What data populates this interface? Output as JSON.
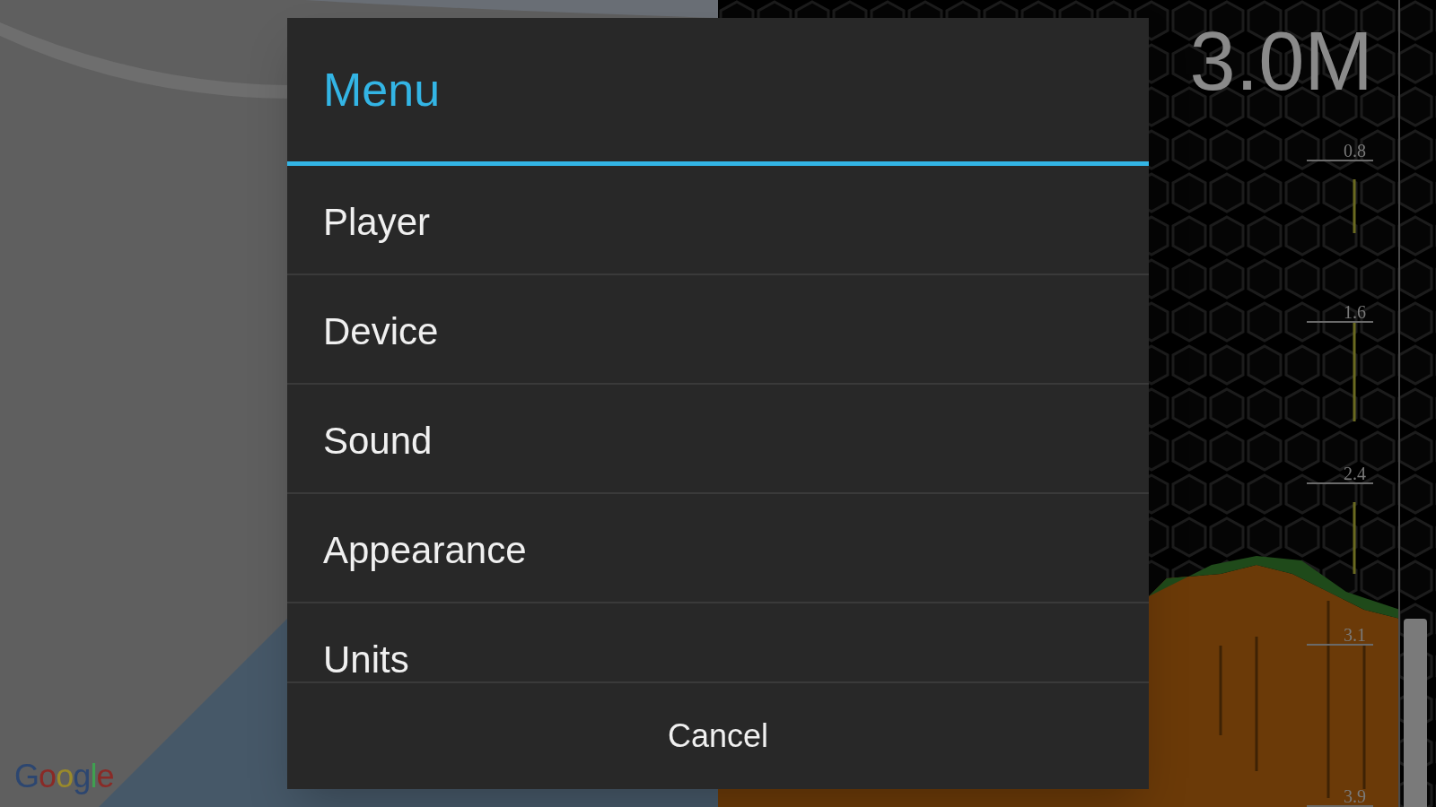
{
  "map": {
    "attribution": "Google"
  },
  "sonar": {
    "depth_reading": "3.0M",
    "depth_scale": [
      "0.8",
      "1.6",
      "2.4",
      "3.1",
      "3.9"
    ]
  },
  "dialog": {
    "title": "Menu",
    "items": [
      {
        "label": "Player"
      },
      {
        "label": "Device"
      },
      {
        "label": "Sound"
      },
      {
        "label": "Appearance"
      },
      {
        "label": "Units"
      }
    ],
    "cancel": "Cancel"
  }
}
